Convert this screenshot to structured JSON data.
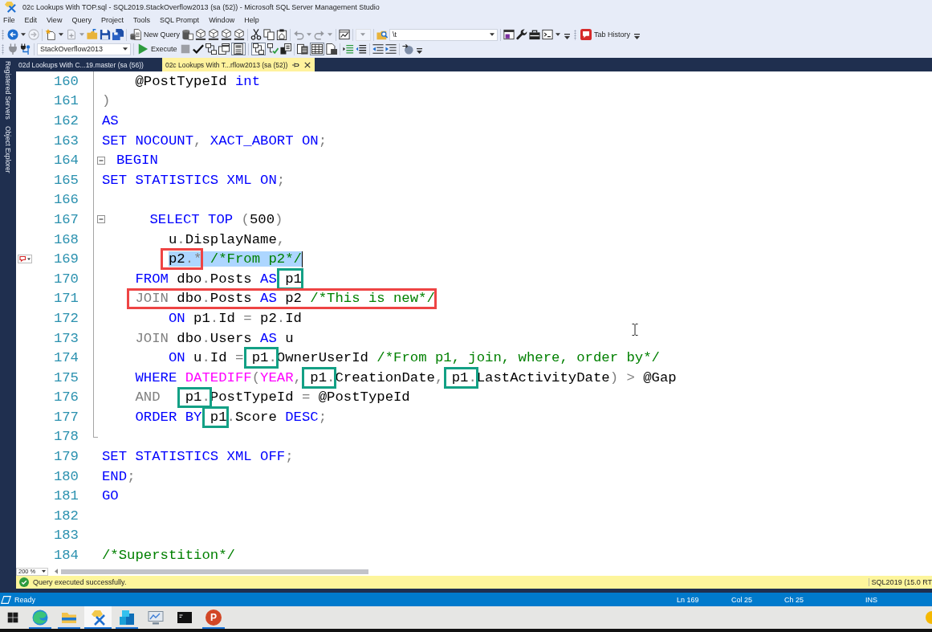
{
  "window": {
    "title": "02c Lookups With TOP.sql - SQL2019.StackOverflow2013 (sa (52)) - Microsoft SQL Server Management Studio"
  },
  "menu": [
    "File",
    "Edit",
    "View",
    "Query",
    "Project",
    "Tools",
    "SQL Prompt",
    "Window",
    "Help"
  ],
  "toolbar_1": {
    "bands": [
      {
        "groups": [
          [
            {
              "kind": "split",
              "disabled": false
            },
            {
              "kind": "button",
              "disabled": true
            }
          ],
          [
            {
              "kind": "split",
              "disabled": false
            },
            {
              "kind": "split",
              "disabled": true
            },
            {
              "kind": "button",
              "disabled": false
            },
            {
              "kind": "button",
              "disabled": false
            },
            {
              "kind": "button",
              "disabled": false
            }
          ],
          [
            {
              "kind": "button",
              "label": "New Query",
              "disabled": false
            },
            {
              "kind": "button",
              "disabled": false
            },
            {
              "kind": "button",
              "disabled": false
            },
            {
              "kind": "button",
              "disabled": false
            },
            {
              "kind": "button",
              "disabled": false
            },
            {
              "kind": "button",
              "disabled": false
            }
          ],
          [
            {
              "kind": "button",
              "disabled": false
            },
            {
              "kind": "button",
              "disabled": false
            },
            {
              "kind": "button",
              "disabled": false
            }
          ],
          [
            {
              "kind": "split",
              "disabled": true
            },
            {
              "kind": "split",
              "disabled": true
            }
          ],
          [
            {
              "kind": "button",
              "disabled": false
            }
          ],
          [
            {
              "kind": "combo",
              "disabled": true
            }
          ],
          [
            {
              "kind": "button",
              "disabled": false
            },
            {
              "kind": "combo",
              "value": "\\t",
              "disabled": false
            }
          ],
          [
            {
              "kind": "button",
              "disabled": false
            },
            {
              "kind": "button",
              "disabled": false
            },
            {
              "kind": "button",
              "disabled": false
            },
            {
              "kind": "split",
              "disabled": false
            }
          ]
        ]
      },
      {
        "groups": [
          [
            {
              "kind": "button",
              "label": "Tab History",
              "disabled": false
            }
          ]
        ]
      }
    ]
  },
  "toolbar_2": {
    "bands": [
      {
        "groups": [
          [
            {
              "kind": "button",
              "disabled": true,
              "pressed": false
            },
            {
              "kind": "button",
              "disabled": false,
              "pressed": false
            }
          ],
          [
            {
              "kind": "combo",
              "value": "StackOverflow2013",
              "disabled": false,
              "pressed": false
            }
          ],
          [
            {
              "kind": "button",
              "label": "Execute",
              "disabled": false,
              "pressed": false
            },
            {
              "kind": "button",
              "disabled": true,
              "pressed": false
            },
            {
              "kind": "button",
              "disabled": false,
              "pressed": false
            },
            {
              "kind": "button",
              "disabled": false,
              "pressed": false
            },
            {
              "kind": "button",
              "disabled": false,
              "pressed": false
            },
            {
              "kind": "button",
              "disabled": false,
              "pressed": true
            }
          ],
          [
            {
              "kind": "button",
              "disabled": false,
              "pressed": true
            },
            {
              "kind": "button",
              "disabled": false,
              "pressed": false
            },
            {
              "kind": "button",
              "disabled": false,
              "pressed": false
            }
          ],
          [
            {
              "kind": "button",
              "disabled": false,
              "pressed": false
            },
            {
              "kind": "button",
              "disabled": false,
              "pressed": true
            },
            {
              "kind": "button",
              "disabled": false,
              "pressed": false
            }
          ],
          [
            {
              "kind": "button",
              "disabled": false,
              "pressed": false
            },
            {
              "kind": "button",
              "disabled": false,
              "pressed": false
            }
          ],
          [
            {
              "kind": "button",
              "disabled": false,
              "pressed": false
            },
            {
              "kind": "button",
              "disabled": false,
              "pressed": false
            }
          ],
          [
            {
              "kind": "button",
              "disabled": false,
              "pressed": false
            }
          ]
        ]
      }
    ]
  },
  "side_panels": [
    "Registered Servers",
    "Object Explorer"
  ],
  "document_tabs": [
    {
      "label": "02d Lookups With C...19.master (sa (56))",
      "selected": false
    },
    {
      "label": "02c Lookups With T...rflow2013 (sa (52))",
      "selected": true
    }
  ],
  "editor": {
    "lines": [
      {
        "num": "160",
        "kind": "inner",
        "marker": false,
        "tokens": [
          {
            "text": "    @PostTypeId ",
            "kind": "plain"
          },
          {
            "text": "int",
            "kind": "keyword"
          }
        ]
      },
      {
        "num": "161",
        "kind": "inner",
        "marker": false,
        "tokens": [
          {
            "text": ")",
            "kind": "operator"
          }
        ]
      },
      {
        "num": "162",
        "kind": "inner",
        "marker": false,
        "tokens": [
          {
            "text": "AS",
            "kind": "keyword"
          }
        ]
      },
      {
        "num": "163",
        "kind": "inner",
        "marker": false,
        "tokens": [
          {
            "text": "SET NOCOUNT",
            "kind": "keyword"
          },
          {
            "text": ",",
            "kind": "operator"
          },
          {
            "text": " XACT_ABORT ON",
            "kind": "keyword"
          },
          {
            "text": ";",
            "kind": "operator"
          }
        ]
      },
      {
        "num": "164",
        "kind": "opener",
        "marker": false,
        "tokens": [
          {
            "text": "BEGIN",
            "kind": "keyword"
          }
        ]
      },
      {
        "num": "165",
        "kind": "inner",
        "marker": false,
        "tokens": [
          {
            "text": "SET STATISTICS XML ON",
            "kind": "keyword"
          },
          {
            "text": ";",
            "kind": "operator"
          }
        ]
      },
      {
        "num": "166",
        "kind": "inner",
        "marker": false
      },
      {
        "num": "167",
        "kind": "opener",
        "marker": false,
        "tokens": [
          {
            "text": "    SELECT TOP ",
            "kind": "keyword"
          },
          {
            "text": "(",
            "kind": "operator"
          },
          {
            "text": "500",
            "kind": "plain"
          },
          {
            "text": ")",
            "kind": "operator"
          }
        ]
      },
      {
        "num": "168",
        "kind": "inner",
        "marker": false,
        "tokens": [
          {
            "text": "        u",
            "kind": "plain"
          },
          {
            "text": ".",
            "kind": "operator"
          },
          {
            "text": "DisplayName",
            "kind": "plain"
          },
          {
            "text": ",",
            "kind": "operator"
          }
        ]
      },
      {
        "num": "169",
        "kind": "inner",
        "marker": true,
        "tokens": [
          {
            "kind": "selection",
            "tokens": [
              {
                "kind": "box",
                "color": "#ee4444",
                "tokens": [
                  {
                    "text": "        p2",
                    "kind": "plain"
                  },
                  {
                    "text": ".*",
                    "kind": "operator"
                  }
                ]
              },
              {
                "text": " /*From p2*/",
                "kind": "comment"
              }
            ]
          },
          {
            "kind": "caret"
          }
        ]
      },
      {
        "num": "170",
        "kind": "inner",
        "marker": false,
        "tokens": [
          {
            "text": "    FROM",
            "kind": "keyword"
          },
          {
            "text": " dbo",
            "kind": "plain"
          },
          {
            "text": ".",
            "kind": "operator"
          },
          {
            "text": "Posts ",
            "kind": "plain"
          },
          {
            "text": "AS",
            "kind": "keyword"
          },
          {
            "kind": "box",
            "color": "#13a085",
            "tokens": [
              {
                "text": " p1",
                "kind": "plain"
              }
            ]
          }
        ]
      },
      {
        "num": "171",
        "kind": "inner",
        "marker": false,
        "tokens": [
          {
            "kind": "box",
            "color": "#ee4444",
            "tokens": [
              {
                "text": "    JOIN",
                "kind": "operator"
              },
              {
                "text": " dbo",
                "kind": "plain"
              },
              {
                "text": ".",
                "kind": "operator"
              },
              {
                "text": "Posts ",
                "kind": "plain"
              },
              {
                "text": "AS",
                "kind": "keyword"
              },
              {
                "text": " p2 ",
                "kind": "plain"
              },
              {
                "text": "/*This is new*/",
                "kind": "comment"
              }
            ]
          }
        ]
      },
      {
        "num": "172",
        "kind": "inner",
        "marker": false,
        "tokens": [
          {
            "text": "        ON",
            "kind": "keyword"
          },
          {
            "text": " p1",
            "kind": "plain"
          },
          {
            "text": ".",
            "kind": "operator"
          },
          {
            "text": "Id ",
            "kind": "plain"
          },
          {
            "text": "=",
            "kind": "operator"
          },
          {
            "text": " p2",
            "kind": "plain"
          },
          {
            "text": ".",
            "kind": "operator"
          },
          {
            "text": "Id",
            "kind": "plain"
          }
        ]
      },
      {
        "num": "173",
        "kind": "inner",
        "marker": false,
        "tokens": [
          {
            "text": "    JOIN",
            "kind": "operator"
          },
          {
            "text": " dbo",
            "kind": "plain"
          },
          {
            "text": ".",
            "kind": "operator"
          },
          {
            "text": "Users ",
            "kind": "plain"
          },
          {
            "text": "AS",
            "kind": "keyword"
          },
          {
            "text": " u",
            "kind": "plain"
          }
        ]
      },
      {
        "num": "174",
        "kind": "inner",
        "marker": false,
        "tokens": [
          {
            "text": "        ON",
            "kind": "keyword"
          },
          {
            "text": " u",
            "kind": "plain"
          },
          {
            "text": ".",
            "kind": "operator"
          },
          {
            "text": "Id ",
            "kind": "plain"
          },
          {
            "text": "=",
            "kind": "operator"
          },
          {
            "kind": "box",
            "color": "#13a085",
            "tokens": [
              {
                "text": " p1",
                "kind": "plain"
              },
              {
                "text": ".",
                "kind": "operator"
              }
            ]
          },
          {
            "text": "OwnerUserId ",
            "kind": "plain"
          },
          {
            "text": "/*From p1, join, where, order by*/",
            "kind": "comment"
          }
        ]
      },
      {
        "num": "175",
        "kind": "inner",
        "marker": false,
        "tokens": [
          {
            "text": "    WHERE ",
            "kind": "keyword"
          },
          {
            "text": "DATEDIFF",
            "kind": "function"
          },
          {
            "text": "(",
            "kind": "operator"
          },
          {
            "text": "YEAR",
            "kind": "function"
          },
          {
            "text": ",",
            "kind": "operator"
          },
          {
            "kind": "box",
            "color": "#13a085",
            "tokens": [
              {
                "text": " p1",
                "kind": "plain"
              },
              {
                "text": ".",
                "kind": "operator"
              }
            ]
          },
          {
            "text": "CreationDate",
            "kind": "plain"
          },
          {
            "text": ",",
            "kind": "operator"
          },
          {
            "kind": "box",
            "color": "#13a085",
            "tokens": [
              {
                "text": " p1",
                "kind": "plain"
              },
              {
                "text": ".",
                "kind": "operator"
              }
            ]
          },
          {
            "text": "LastActivityDate",
            "kind": "plain"
          },
          {
            "text": ")",
            "kind": "operator"
          },
          {
            "text": " >",
            "kind": "operator"
          },
          {
            "text": " @Gap",
            "kind": "plain"
          }
        ]
      },
      {
        "num": "176",
        "kind": "inner",
        "marker": false,
        "tokens": [
          {
            "text": "    AND",
            "kind": "operator"
          },
          {
            "kind": "box",
            "color": "#13a085",
            "tokens": [
              {
                "text": "   p1",
                "kind": "plain"
              },
              {
                "text": ".",
                "kind": "operator"
              }
            ]
          },
          {
            "text": "PostTypeId ",
            "kind": "plain"
          },
          {
            "text": "=",
            "kind": "operator"
          },
          {
            "text": " @PostTypeId",
            "kind": "plain"
          }
        ]
      },
      {
        "num": "177",
        "kind": "inner",
        "marker": false,
        "tokens": [
          {
            "text": "    ORDER BY",
            "kind": "keyword"
          },
          {
            "kind": "box",
            "color": "#13a085",
            "tokens": [
              {
                "text": " p1",
                "kind": "plain"
              }
            ]
          },
          {
            "text": ".",
            "kind": "operator"
          },
          {
            "text": "Score ",
            "kind": "plain"
          },
          {
            "text": "DESC",
            "kind": "keyword"
          },
          {
            "text": ";",
            "kind": "operator"
          }
        ]
      },
      {
        "num": "178",
        "kind": "closer",
        "marker": false
      },
      {
        "num": "179",
        "kind": "outside",
        "marker": false,
        "tokens": [
          {
            "text": "SET STATISTICS XML OFF",
            "kind": "keyword"
          },
          {
            "text": ";",
            "kind": "operator"
          }
        ]
      },
      {
        "num": "180",
        "kind": "outside",
        "marker": false,
        "tokens": [
          {
            "text": "END",
            "kind": "keyword"
          },
          {
            "text": ";",
            "kind": "operator"
          }
        ]
      },
      {
        "num": "181",
        "kind": "outside",
        "marker": false,
        "tokens": [
          {
            "text": "GO",
            "kind": "keyword"
          }
        ]
      },
      {
        "num": "182",
        "kind": "outside",
        "marker": false
      },
      {
        "num": "183",
        "kind": "outside",
        "marker": false
      },
      {
        "num": "184",
        "kind": "outside",
        "marker": false,
        "tokens": [
          {
            "text": "/*Superstition*/",
            "kind": "comment"
          }
        ]
      }
    ],
    "zoom": "200 %"
  },
  "message_bar": {
    "message": "Query executed successfully.",
    "server": "SQL2019 (15.0 RT"
  },
  "status_bar": {
    "state": "Ready",
    "line": "Ln 169",
    "column": "Col 25",
    "char": "Ch 25",
    "mode": "INS"
  },
  "taskbar": {
    "apps": [
      {
        "running": true,
        "selected": false
      },
      {
        "running": true,
        "selected": false
      },
      {
        "running": true,
        "selected": true
      },
      {
        "running": true,
        "selected": false
      },
      {
        "running": false,
        "selected": false
      },
      {
        "running": false,
        "selected": false
      },
      {
        "running": true,
        "selected": false,
        "label": "P"
      }
    ]
  }
}
